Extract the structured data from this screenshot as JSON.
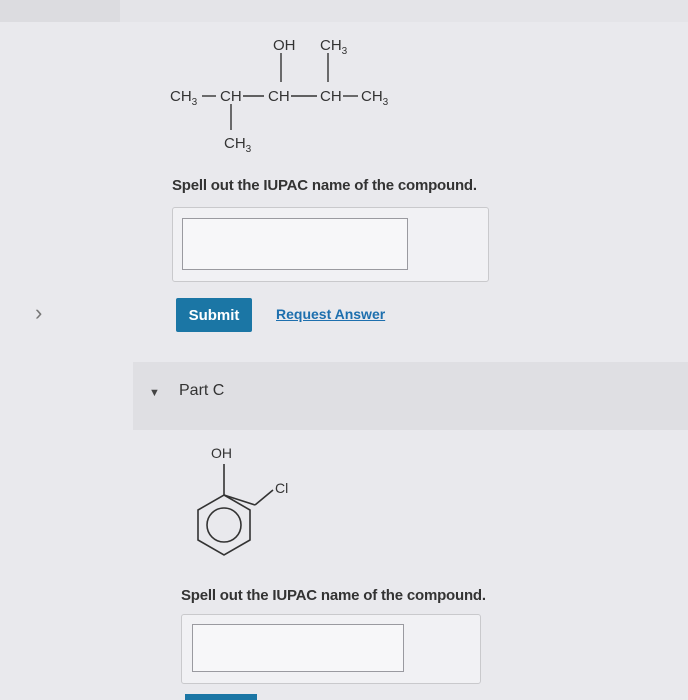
{
  "nav": {
    "expand_glyph": "›"
  },
  "molecule_b": {
    "oh": "OH",
    "ch3_top": "CH",
    "ch3_top_sub": "3",
    "chain": [
      {
        "group": "CH",
        "sub": "3"
      },
      {
        "group": "CH",
        "sub": ""
      },
      {
        "group": "CH",
        "sub": ""
      },
      {
        "group": "CH",
        "sub": ""
      },
      {
        "group": "CH",
        "sub": "3"
      }
    ],
    "ch3_bottom": "CH",
    "ch3_bottom_sub": "3"
  },
  "question_b": {
    "prompt": "Spell out the IUPAC name of the compound.",
    "answer_value": "",
    "submit_label": "Submit",
    "request_label": "Request Answer"
  },
  "part_c": {
    "label": "Part C",
    "caret": "▼",
    "molecule": {
      "oh": "OH",
      "cl": "Cl"
    },
    "prompt": "Spell out the IUPAC name of the compound.",
    "answer_value": ""
  },
  "colors": {
    "accent": "#1b76a5",
    "link": "#1d6fae",
    "background": "#e9e9ed"
  }
}
